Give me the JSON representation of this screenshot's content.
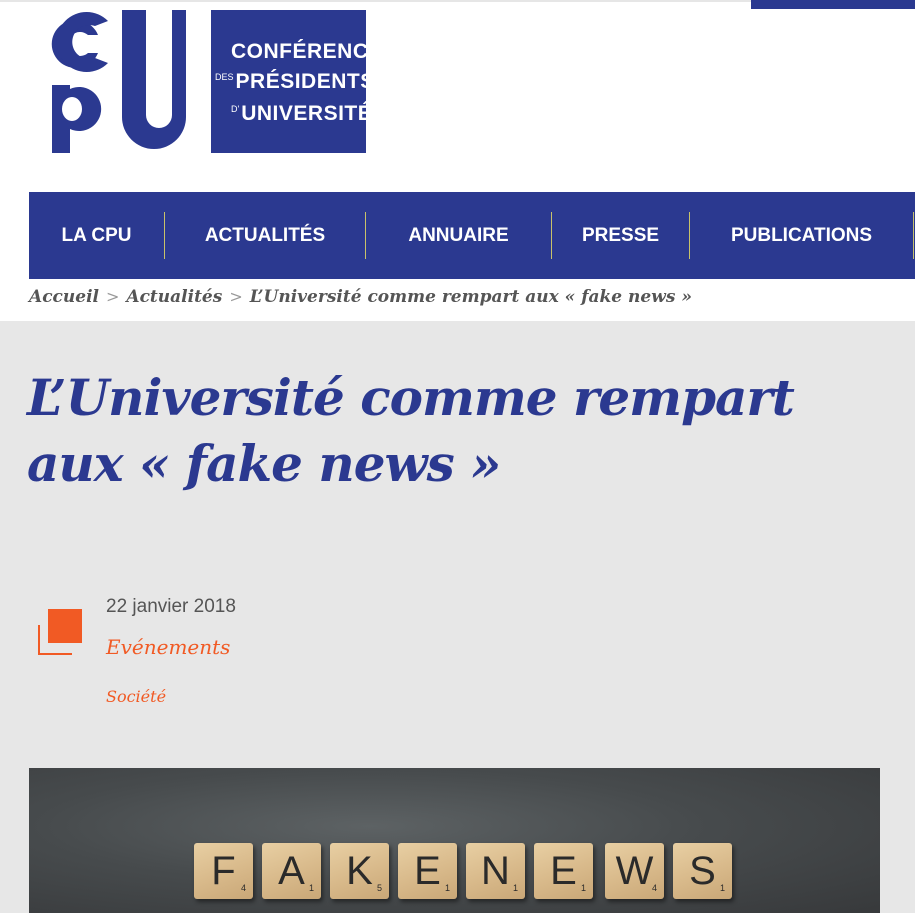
{
  "logo": {
    "line1": "CONFÉRENCE",
    "line2_small": "DES",
    "line2": "PRÉSIDENTS",
    "line3_small": "D'",
    "line3": "UNIVERSITÉ",
    "brand_color": "#2b3990"
  },
  "nav": {
    "items": [
      {
        "label": "LA CPU"
      },
      {
        "label": "ACTUALITÉS"
      },
      {
        "label": "ANNUAIRE"
      },
      {
        "label": "PRESSE"
      },
      {
        "label": "PUBLICATIONS"
      }
    ]
  },
  "breadcrumb": {
    "items": [
      "Accueil",
      "Actualités"
    ],
    "separator": ">",
    "current": "L’Université comme rempart aux « fake news »"
  },
  "article": {
    "title": "L’Université comme rempart aux « fake news »",
    "date": "22 janvier 2018",
    "category": "Evénements",
    "tag": "Société",
    "icon": "category-square-icon",
    "accent_color": "#f15a24"
  },
  "featured_image": {
    "tiles": [
      {
        "letter": "F",
        "score": "4"
      },
      {
        "letter": "A",
        "score": "1"
      },
      {
        "letter": "K",
        "score": "5"
      },
      {
        "letter": "E",
        "score": "1"
      },
      {
        "letter": "N",
        "score": "1"
      },
      {
        "letter": "E",
        "score": "1"
      },
      {
        "letter": "W",
        "score": "4"
      },
      {
        "letter": "S",
        "score": "1"
      }
    ]
  }
}
